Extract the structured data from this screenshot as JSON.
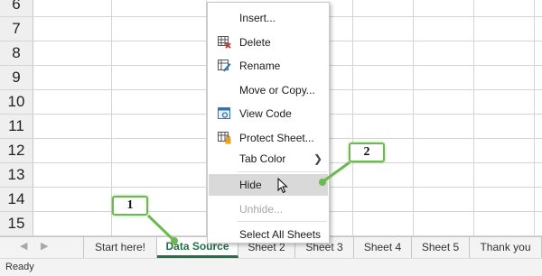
{
  "grid": {
    "row_numbers": [
      "6",
      "7",
      "8",
      "9",
      "10",
      "11",
      "12",
      "13",
      "14",
      "15"
    ]
  },
  "tabs": {
    "items": [
      "Start here!",
      "Data Source",
      "Sheet 2",
      "Sheet 3",
      "Sheet 4",
      "Sheet 5",
      "Thank you"
    ],
    "active_index": 1
  },
  "status": {
    "text": "Ready"
  },
  "context_menu": {
    "insert": "Insert...",
    "delete": "Delete",
    "rename": "Rename",
    "move_or_copy": "Move or Copy...",
    "view_code": "View Code",
    "protect_sheet": "Protect Sheet...",
    "tab_color": "Tab Color",
    "hide": "Hide",
    "unhide": "Unhide...",
    "select_all_sheets": "Select All Sheets"
  },
  "callouts": {
    "first": "1",
    "second": "2"
  },
  "colors": {
    "accent_green": "#217346",
    "callout_green": "#6cb94f"
  }
}
